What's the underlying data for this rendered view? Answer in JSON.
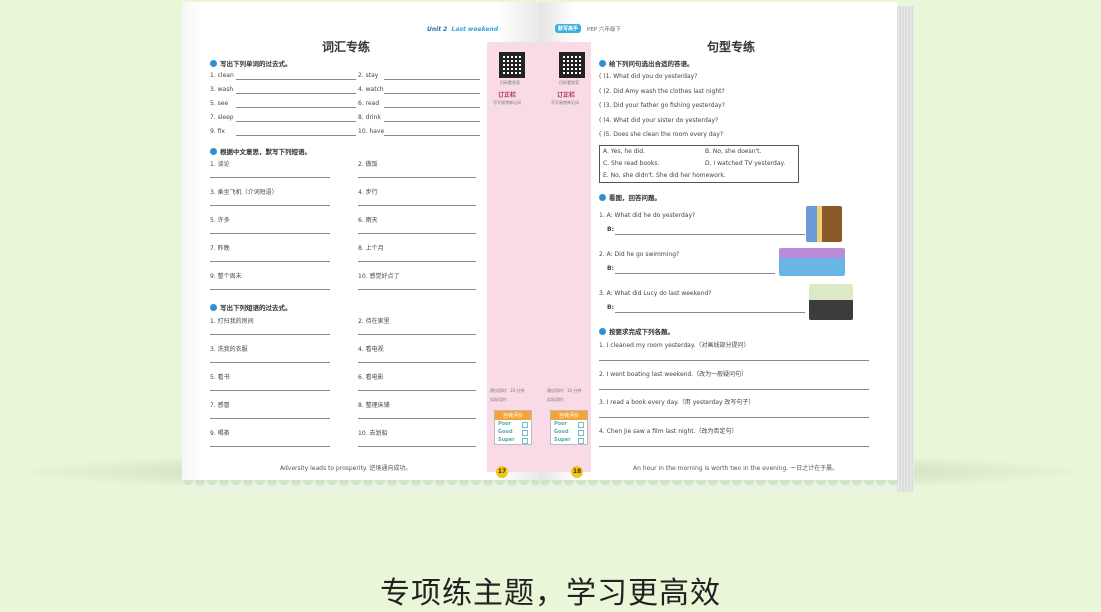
{
  "left": {
    "header_unit": "Unit 2",
    "header_title": "Last weekend",
    "title": "词汇专练",
    "s1": {
      "label": "写出下列单词的过去式。",
      "items": [
        "1. clean",
        "2. stay",
        "3. wash",
        "4. watch",
        "5. see",
        "6. read",
        "7. sleep",
        "8. drink",
        "9. fix",
        "10. have"
      ]
    },
    "s2": {
      "label": "根据中文意思，默写下列短语。",
      "items": [
        "1. 谈论",
        "2. 做饭",
        "3. 乘坐飞机（介词短语）",
        "4. 步行",
        "5. 许多",
        "6. 雨天",
        "7. 昨晚",
        "8. 上个月",
        "9. 整个周末",
        "10. 感觉好点了"
      ]
    },
    "s3": {
      "label": "写出下列短语的过去式。",
      "items": [
        "1. 打扫我的房间",
        "2. 待在家里",
        "3. 洗我的衣服",
        "4. 看电视",
        "5. 看书",
        "6. 看电影",
        "7. 感冒",
        "8. 整理床铺",
        "9. 喝茶",
        "10. 去划船"
      ]
    },
    "footer": "Adversity leads to prosperity. 逆境通向成功。",
    "page_number": "17",
    "side": {
      "qr_caption": "扫码看答案",
      "badge": "订正栏",
      "note": "写写易错单记词",
      "time": "建议用时：10 分钟",
      "actual": "实际用时：",
      "rating_title": "自我评价",
      "ratings": [
        "Poor",
        "Good",
        "Super"
      ]
    }
  },
  "right": {
    "brand": "默写高手",
    "series": "PEP 六年级下",
    "title": "句型专练",
    "s1": {
      "label": "给下列问句选出合适的答语。",
      "items": [
        "(      )1. What did you do yesterday?",
        "(      )2. Did Amy wash the clothes last night?",
        "(      )3. Did your father go fishing yesterday?",
        "(      )4. What did your sister do yesterday?",
        "(      )5. Does she clean the room every day?"
      ],
      "options": [
        "A. Yes, he did.",
        "B. No, she doesn't.",
        "C. She read books.",
        "D. I watched TV yesterday.",
        "E. No, she didn't. She did her homework."
      ]
    },
    "s2": {
      "label": "看图，回答问题。",
      "qs": [
        "1. A: What did he do yesterday?",
        "2. A: Did he go swimming?",
        "3. A: What did Lucy do last weekend?"
      ],
      "b": "B:"
    },
    "s3": {
      "label": "按要求完成下列各题。",
      "items": [
        "1. I cleaned my room yesterday.（对画线部分提问）",
        "2. I went boating last weekend.（改为一般疑问句）",
        "3. I read a book every day.（用 yesterday 改写句子）",
        "4. Chen Jie saw a film last night.（改为否定句）"
      ]
    },
    "footer": "An hour in the morning is worth two in the evening. 一日之计在于晨。",
    "page_number": "18",
    "side": {
      "qr_caption": "扫码看答案",
      "badge": "订正栏",
      "note": "写写易错单记词",
      "time": "建议用时：10 分钟",
      "actual": "实际用时：",
      "rating_title": "自我评价",
      "ratings": [
        "Poor",
        "Good",
        "Super"
      ]
    }
  },
  "caption": "专项练主题，学习更高效",
  "colors": {
    "background": "#eaf6d8",
    "accent": "#2f8fd8",
    "pink_column": "#f8dbe6",
    "page_badge": "#f5c518"
  }
}
